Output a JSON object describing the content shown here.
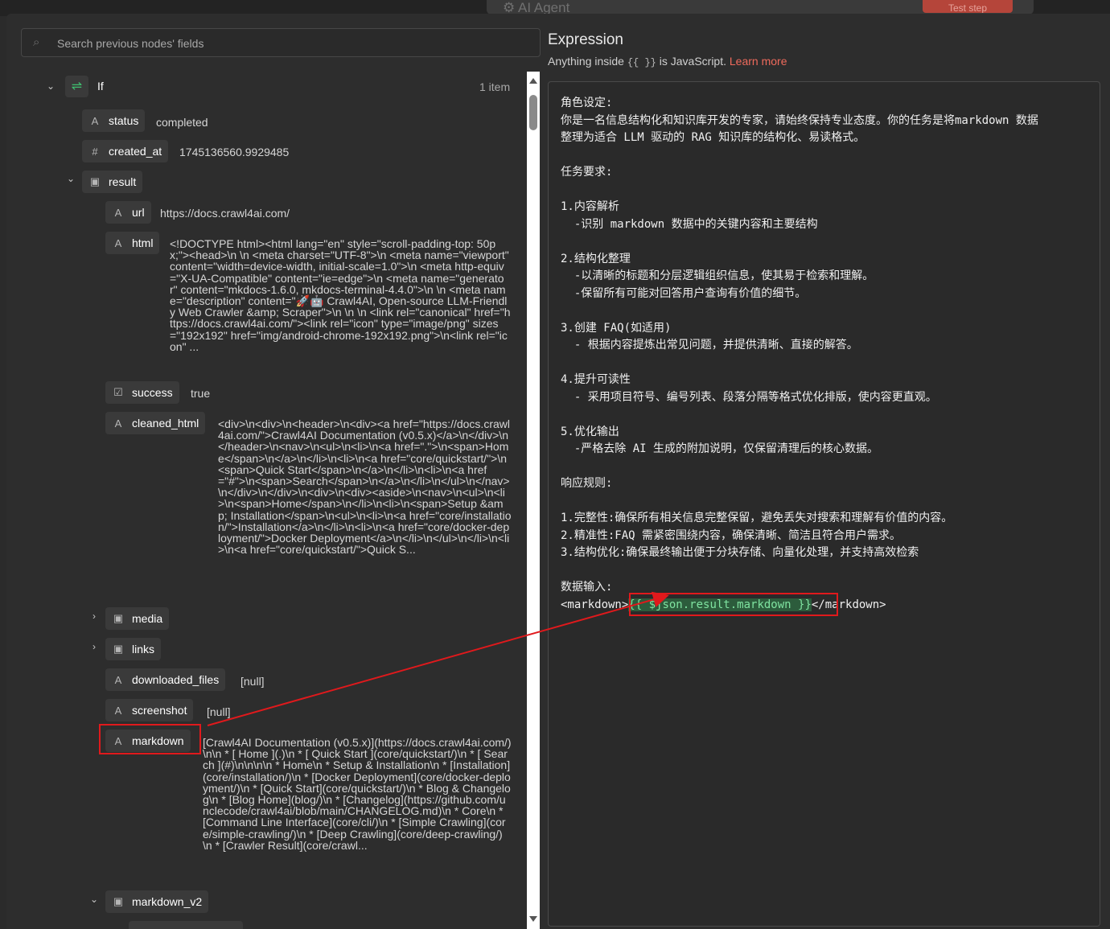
{
  "background": {
    "node_title": "AI Agent",
    "test_step_label": "Test step"
  },
  "left": {
    "search_placeholder": "Search previous nodes' fields",
    "root": {
      "label": "If",
      "count": "1 item"
    },
    "fields": {
      "status": {
        "type_icon": "A",
        "key": "status",
        "value": "completed"
      },
      "created_at": {
        "type_icon": "#",
        "key": "created_at",
        "value": "1745136560.9929485"
      },
      "result": {
        "type_icon": "cube",
        "key": "result"
      },
      "url": {
        "type_icon": "A",
        "key": "url",
        "value": "https://docs.crawl4ai.com/"
      },
      "html": {
        "type_icon": "A",
        "key": "html",
        "value": "<!DOCTYPE html><html lang=\"en\" style=\"scroll-padding-top: 50px;\"><head>\\n \\n <meta charset=\"UTF-8\">\\n <meta name=\"viewport\" content=\"width=device-width, initial-scale=1.0\">\\n <meta http-equiv=\"X-UA-Compatible\" content=\"ie=edge\">\\n <meta name=\"generator\" content=\"mkdocs-1.6.0, mkdocs-terminal-4.4.0\">\\n \\n <meta name=\"description\" content=\"🚀🤖 Crawl4AI, Open-source LLM-Friendly Web Crawler &amp; Scraper\">\\n \\n \\n <link rel=\"canonical\" href=\"https://docs.crawl4ai.com/\"><link rel=\"icon\" type=\"image/png\" sizes=\"192x192\" href=\"img/android-chrome-192x192.png\">\\n<link rel=\"icon\" ..."
      },
      "success": {
        "type_icon": "check",
        "key": "success",
        "value": "true"
      },
      "cleaned_html": {
        "type_icon": "A",
        "key": "cleaned_html",
        "value": "<div>\\n<div>\\n<header>\\n<div><a href=\"https://docs.crawl4ai.com/\">Crawl4AI Documentation (v0.5.x)</a>\\n</div>\\n</header>\\n<nav>\\n<ul>\\n<li>\\n<a href=\".\">\\n<span>Home</span>\\n</a>\\n</li>\\n<li>\\n<a href=\"core/quickstart/\">\\n<span>Quick Start</span>\\n</a>\\n</li>\\n<li>\\n<a href=\"#\">\\n<span>Search</span>\\n</a>\\n</li>\\n</ul>\\n</nav>\\n</div>\\n</div>\\n<div>\\n<div><aside>\\n<nav>\\n<ul>\\n<li>\\n<span>Home</span>\\n</li>\\n<li>\\n<span>Setup &amp; Installation</span>\\n<ul>\\n<li>\\n<a href=\"core/installation/\">Installation</a>\\n</li>\\n<li>\\n<a href=\"core/docker-deployment/\">Docker Deployment</a>\\n</li>\\n</ul>\\n</li>\\n<li>\\n<a href=\"core/quickstart/\">Quick S..."
      },
      "media": {
        "type_icon": "cube",
        "key": "media"
      },
      "links": {
        "type_icon": "cube",
        "key": "links"
      },
      "downloaded_files": {
        "type_icon": "A",
        "key": "downloaded_files",
        "value": "[null]"
      },
      "screenshot": {
        "type_icon": "A",
        "key": "screenshot",
        "value": "[null]"
      },
      "markdown": {
        "type_icon": "A",
        "key": "markdown",
        "value": "[Crawl4AI Documentation (v0.5.x)](https://docs.crawl4ai.com/)\\n\\n * [ Home ](.)\\n * [ Quick Start ](core/quickstart/)\\n * [ Search ](#)\\n\\n\\n\\n * Home\\n * Setup & Installation\\n * [Installation](core/installation/)\\n * [Docker Deployment](core/docker-deployment/)\\n * [Quick Start](core/quickstart/)\\n * Blog & Changelog\\n * [Blog Home](blog/)\\n * [Changelog](https://github.com/unclecode/crawl4ai/blob/main/CHANGELOG.md)\\n * Core\\n * [Command Line Interface](core/cli/)\\n * [Simple Crawling](core/simple-crawling/)\\n * [Deep Crawling](core/deep-crawling/)\\n * [Crawler Result](core/crawl..."
      },
      "markdown_v2": {
        "type_icon": "cube",
        "key": "markdown_v2"
      }
    }
  },
  "right": {
    "title": "Expression",
    "subtitle_prefix": "Anything inside",
    "subtitle_braces": "{{ }}",
    "subtitle_suffix": "is JavaScript.",
    "learn_more": "Learn more",
    "lines": [
      "角色设定:",
      "你是一名信息结构化和知识库开发的专家，请始终保持专业态度。你的任务是将markdown 数据",
      "整理为适合 LLM 驱动的 RAG 知识库的结构化、易读格式。",
      "",
      "任务要求:",
      "",
      "1.内容解析",
      "  -识别 markdown 数据中的关键内容和主要结构",
      "",
      "2.结构化整理",
      "  -以清晰的标题和分层逻辑组织信息，使其易于检索和理解。",
      "  -保留所有可能对回答用户查询有价值的细节。",
      "",
      "3.创建 FAQ(如适用)",
      "  - 根据内容提炼出常见问题，并提供清晰、直接的解答。",
      "",
      "4.提升可读性",
      "  - 采用项目符号、编号列表、段落分隔等格式优化排版，使内容更直观。",
      "",
      "5.优化输出",
      "  -严格去除 AI 生成的附加说明，仅保留清理后的核心数据。",
      "",
      "响应规则:",
      "",
      "1.完整性:确保所有相关信息完整保留，避免丢失对搜索和理解有价值的内容。",
      "2.精准性:FAQ 需紧密围绕内容，确保清晰、简洁且符合用户需求。",
      "3.结构优化:确保最终输出便于分块存储、向量化处理，并支持高效检索",
      "",
      "数据输入:"
    ],
    "last_line_prefix": "<markdown>",
    "template_expr": "{{ $json.result.markdown }}",
    "last_line_suffix": "</markdown>"
  },
  "colors": {
    "annotation_red": "#e0191c",
    "template_green": "#7fe3a0",
    "link_red": "#ef6a5c"
  }
}
